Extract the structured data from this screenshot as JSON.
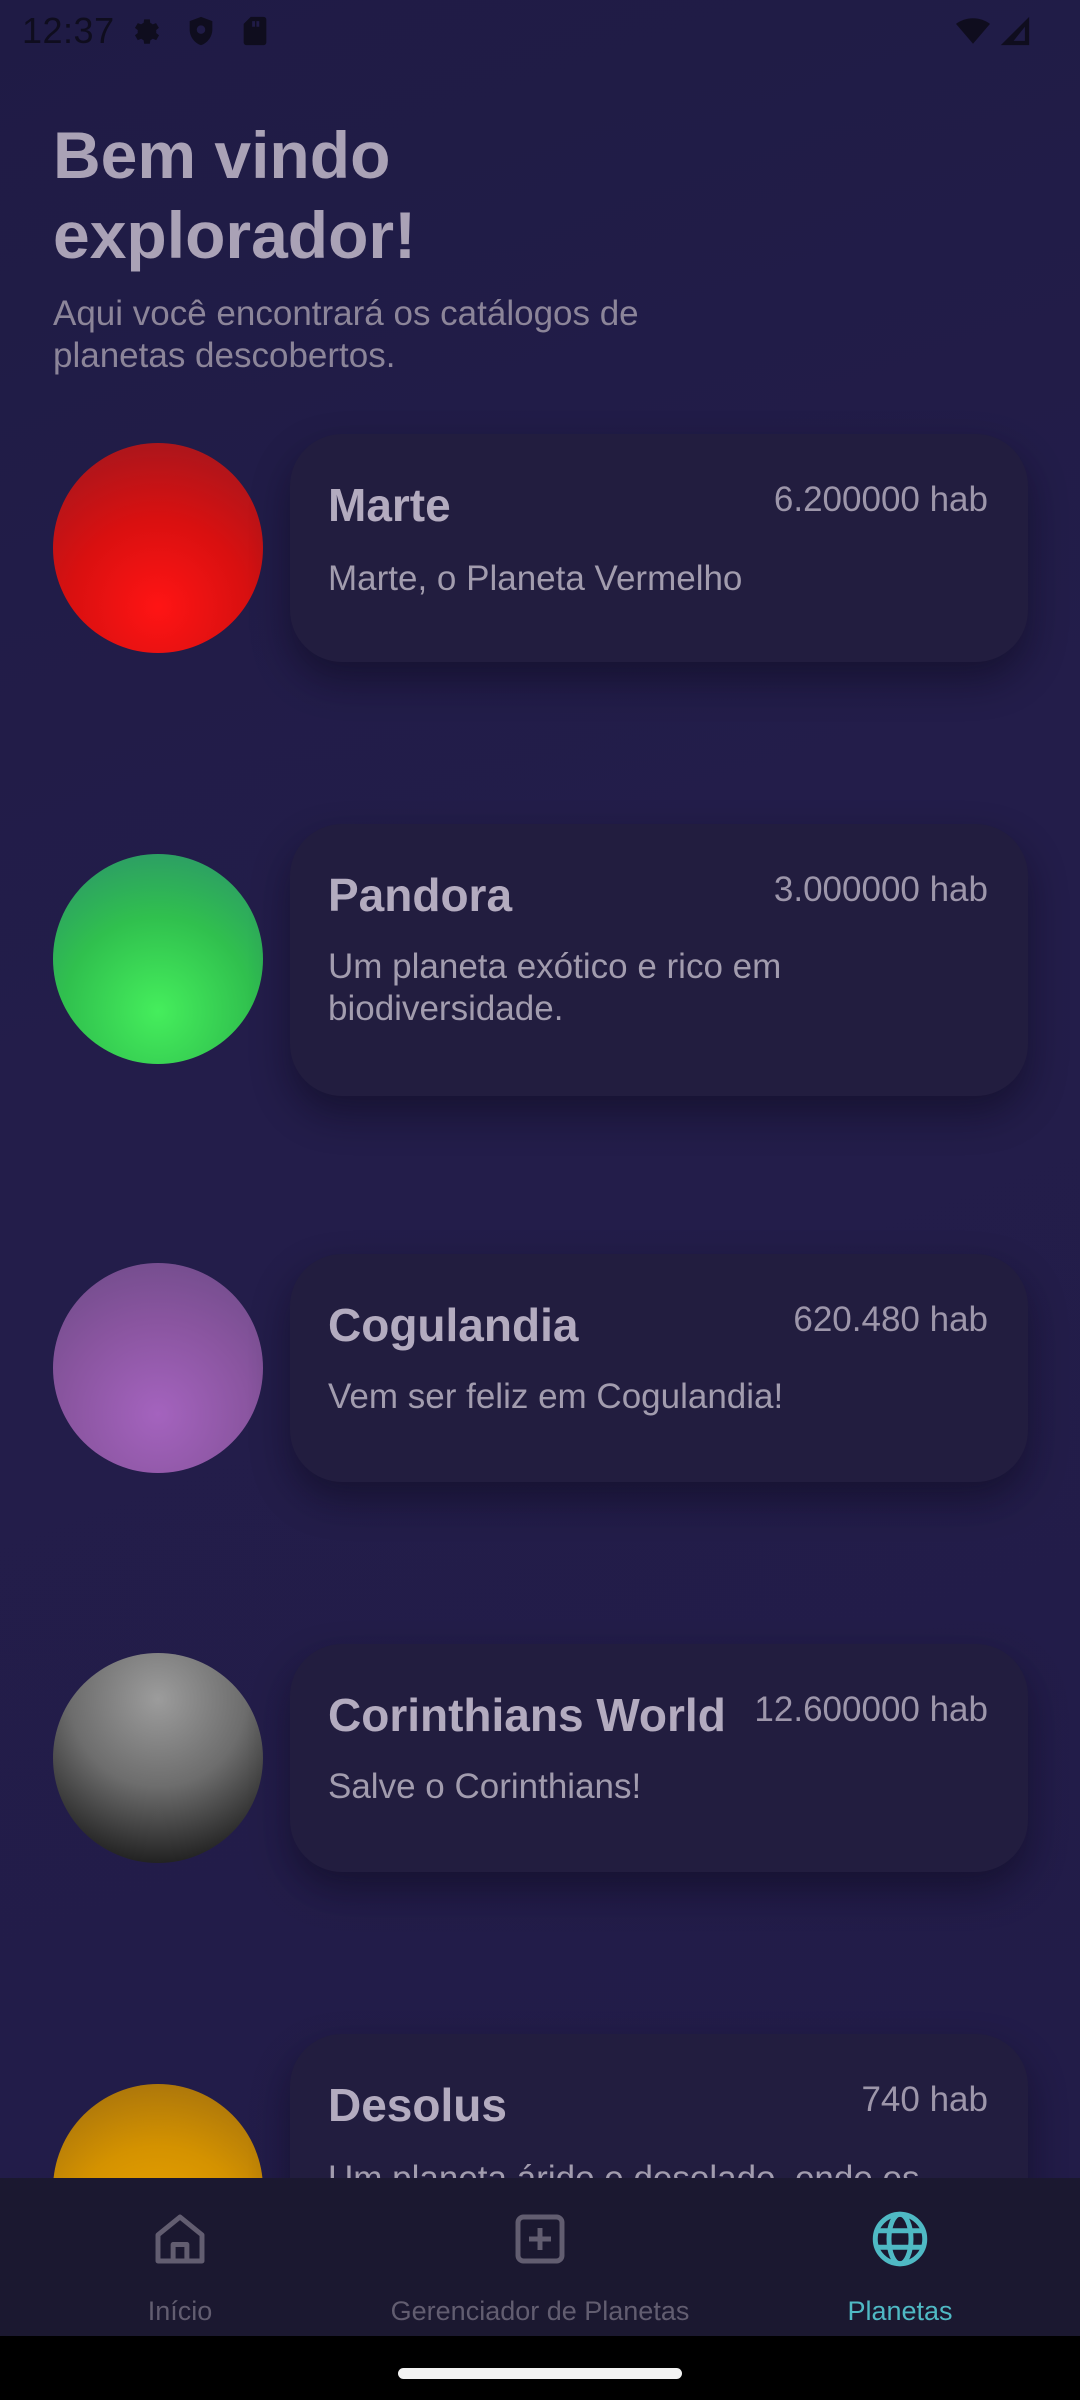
{
  "status_bar": {
    "time": "12:37"
  },
  "header": {
    "title_line1": "Bem vindo",
    "title_line2": "explorador!",
    "subtitle_line1": "Aqui você encontrará os catálogos de",
    "subtitle_line2": "planetas descobertos."
  },
  "planets": [
    {
      "name": "Marte",
      "population": "6.200000 hab",
      "description_lines": [
        "Marte, o Planeta Vermelho"
      ],
      "color": "#ff1010"
    },
    {
      "name": "Pandora",
      "population": "3.000000 hab",
      "description_lines": [
        "Um planeta exótico e rico em",
        "biodiversidade."
      ],
      "color": "#3ee055"
    },
    {
      "name": "Cogulandia",
      "population": "620.480 hab",
      "description_lines": [
        "Vem ser feliz em Cogulandia!"
      ],
      "color": "#9a5fae"
    },
    {
      "name": "Corinthians World",
      "population": "12.600000 hab",
      "description_lines": [
        "Salve o Corinthians!"
      ],
      "color": "#8a8a8a"
    },
    {
      "name": "Desolus",
      "population": "740 hab",
      "description_lines": [
        "Um planeta árido e desolado, onde os"
      ],
      "color": "#e5a000"
    }
  ],
  "bottom_nav": {
    "items": [
      {
        "label": "Início",
        "icon": "home-icon",
        "active": false
      },
      {
        "label": "Gerenciador de Planetas",
        "icon": "add-box-icon",
        "active": false
      },
      {
        "label": "Planetas",
        "icon": "globe-icon",
        "active": true
      }
    ],
    "active_color": "#4fb9c4",
    "inactive_color": "#625d70"
  }
}
